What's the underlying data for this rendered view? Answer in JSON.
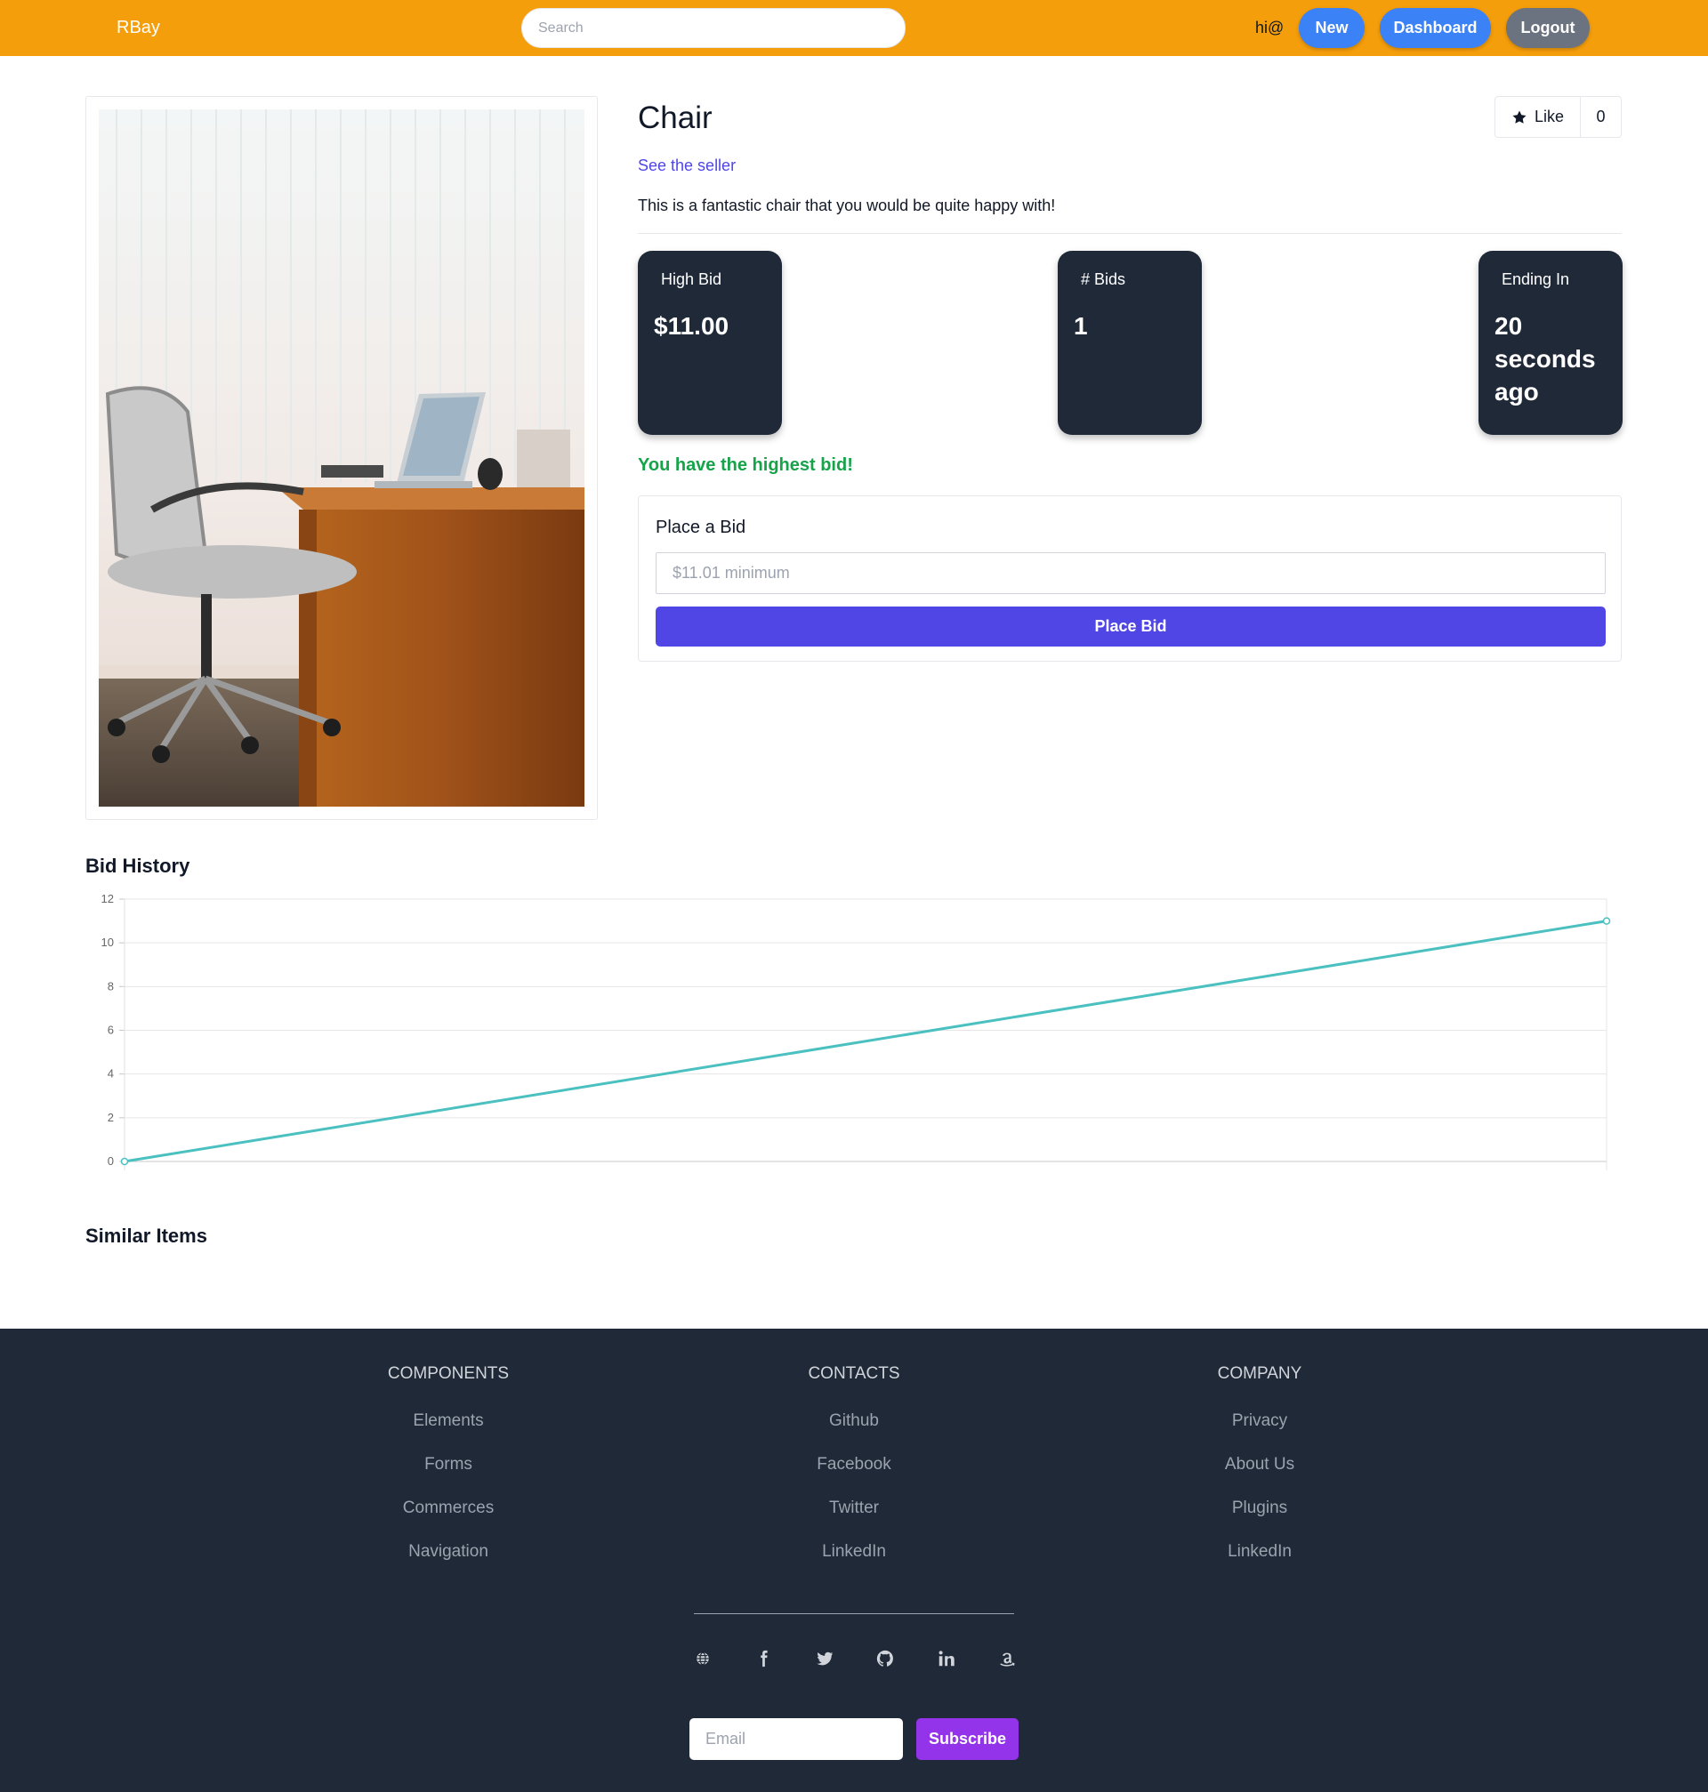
{
  "navbar": {
    "brand": "RBay",
    "search_placeholder": "Search",
    "greeting": "hi@",
    "new_label": "New",
    "dashboard_label": "Dashboard",
    "logout_label": "Logout",
    "colors": {
      "bar": "#f59e0b",
      "primary": "#3b82f6",
      "secondary": "#6b7280"
    }
  },
  "item": {
    "title": "Chair",
    "like_label": "Like",
    "like_count": "0",
    "seller_link": "See the seller",
    "description": "This is a fantastic chair that you would be quite happy with!",
    "image_alt": "office chair next to a wooden desk with a laptop"
  },
  "stats": [
    {
      "label": "High Bid",
      "value": "$11.00"
    },
    {
      "label": "# Bids",
      "value": "1"
    },
    {
      "label": "Ending In",
      "value": "20 seconds ago"
    }
  ],
  "bid_status": "You have the highest bid!",
  "bid_form": {
    "title": "Place a Bid",
    "placeholder": "$11.01 minimum",
    "button_label": "Place Bid"
  },
  "sections": {
    "bid_history": "Bid History",
    "similar_items": "Similar Items"
  },
  "chart_data": {
    "type": "line",
    "title": "",
    "xlabel": "",
    "ylabel": "",
    "x": [
      0,
      1
    ],
    "series": [
      {
        "values": [
          0,
          11
        ],
        "color": "#4bc0c0"
      }
    ],
    "ylim": [
      0,
      12
    ],
    "yticks": [
      0,
      2,
      4,
      6,
      8,
      10,
      12
    ],
    "grid": true
  },
  "footer": {
    "columns": [
      {
        "heading": "COMPONENTS",
        "links": [
          "Elements",
          "Forms",
          "Commerces",
          "Navigation"
        ]
      },
      {
        "heading": "CONTACTS",
        "links": [
          "Github",
          "Facebook",
          "Twitter",
          "LinkedIn"
        ]
      },
      {
        "heading": "COMPANY",
        "links": [
          "Privacy",
          "About Us",
          "Plugins",
          "LinkedIn"
        ]
      }
    ],
    "social_icons": [
      "globe-icon",
      "facebook-icon",
      "twitter-icon",
      "github-icon",
      "linkedin-icon",
      "amazon-icon"
    ],
    "email_placeholder": "Email",
    "subscribe_label": "Subscribe"
  }
}
